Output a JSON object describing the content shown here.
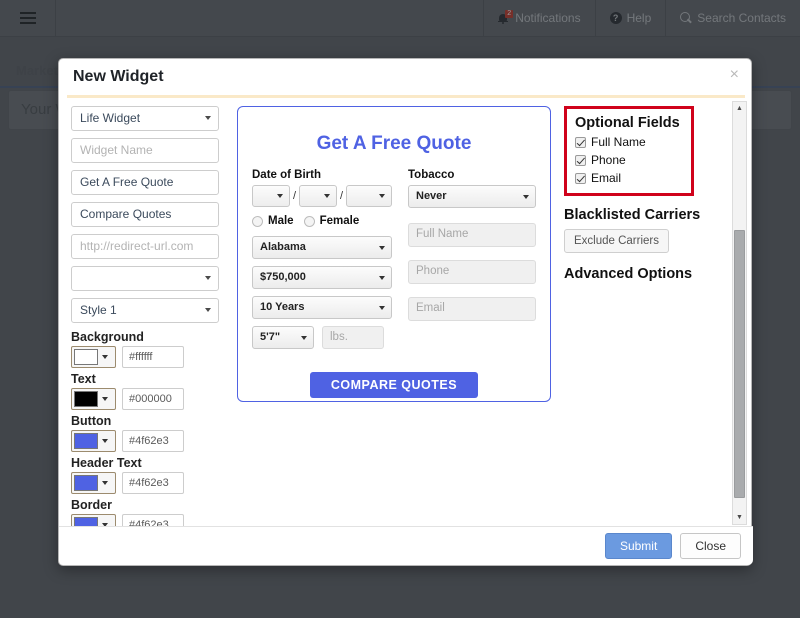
{
  "topnav": {
    "menu_icon": "hamburger-icon",
    "items": [
      {
        "icon": "bell-icon",
        "label": "Notifications",
        "badge": "2"
      },
      {
        "icon": "help-circle-icon",
        "label": "Help"
      },
      {
        "icon": "search-icon",
        "label": "Search Contacts"
      }
    ]
  },
  "background": {
    "breadcrumb": "Marketi",
    "panel_title": "Your W"
  },
  "modal": {
    "title": "New Widget",
    "close_icon": "×",
    "footer": {
      "submit_label": "Submit",
      "close_label": "Close"
    }
  },
  "left_form": {
    "widget_type": "Life Widget",
    "widget_name_placeholder": "Widget Name",
    "headline": "Get A Free Quote",
    "button_text": "Compare Quotes",
    "redirect_placeholder": "http://redirect-url.com",
    "empty_select": "",
    "style": "Style 1",
    "colors": [
      {
        "label": "Background",
        "hex": "#ffffff",
        "swatch": "#ffffff"
      },
      {
        "label": "Text",
        "hex": "#000000",
        "swatch": "#000000"
      },
      {
        "label": "Button",
        "hex": "#4f62e3",
        "swatch": "#4f62e3"
      },
      {
        "label": "Header Text",
        "hex": "#4f62e3",
        "swatch": "#4f62e3"
      },
      {
        "label": "Border",
        "hex": "#4f62e3",
        "swatch": "#4f62e3"
      }
    ]
  },
  "preview": {
    "title": "Get A Free Quote",
    "dob_label": "Date of Birth",
    "dob_month": "",
    "dob_day": "",
    "dob_year": "",
    "slash": "/",
    "gender_male": "Male",
    "gender_female": "Female",
    "state": "Alabama",
    "coverage": "$750,000",
    "term": "10 Years",
    "height": "5'7\"",
    "weight_placeholder": "lbs.",
    "tobacco_label": "Tobacco",
    "tobacco_value": "Never",
    "fullname_placeholder": "Full Name",
    "phone_placeholder": "Phone",
    "email_placeholder": "Email",
    "cta_label": "COMPARE QUOTES",
    "accent_color": "#4f62e3"
  },
  "right_panel": {
    "optional_fields_title": "Optional Fields",
    "optional_fields": [
      {
        "label": "Full Name",
        "checked": true
      },
      {
        "label": "Phone",
        "checked": true
      },
      {
        "label": "Email",
        "checked": true
      }
    ],
    "highlight_color": "#d0021b",
    "blacklisted_title": "Blacklisted Carriers",
    "exclude_button": "Exclude Carriers",
    "advanced_title": "Advanced Options"
  }
}
